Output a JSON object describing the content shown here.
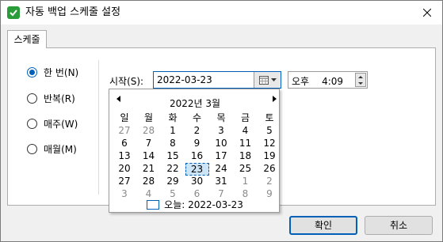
{
  "window": {
    "title": "자동 백업 스케줄 설정"
  },
  "tab": {
    "label": "스케줄"
  },
  "radios": [
    {
      "label": "한 번(N)",
      "checked": true
    },
    {
      "label": "반복(R)",
      "checked": false
    },
    {
      "label": "매주(W)",
      "checked": false
    },
    {
      "label": "매월(M)",
      "checked": false
    }
  ],
  "start": {
    "label": "시작(S):",
    "date_value": "2022-03-23"
  },
  "time": {
    "ampm": "오후",
    "value": "4:09"
  },
  "calendar": {
    "title": "2022년 3월",
    "weekdays": [
      "일",
      "월",
      "화",
      "수",
      "목",
      "금",
      "토"
    ],
    "weeks": [
      [
        "27",
        "28",
        "1",
        "2",
        "3",
        "4",
        "5"
      ],
      [
        "6",
        "7",
        "8",
        "9",
        "10",
        "11",
        "12"
      ],
      [
        "13",
        "14",
        "15",
        "16",
        "17",
        "18",
        "19"
      ],
      [
        "20",
        "21",
        "22",
        "23",
        "24",
        "25",
        "26"
      ],
      [
        "27",
        "28",
        "29",
        "30",
        "31",
        "1",
        "2"
      ],
      [
        "3",
        "4",
        "5",
        "6",
        "7",
        "8",
        "9"
      ]
    ],
    "selected_day": "23",
    "today_label": "오늘: 2022-03-23"
  },
  "buttons": {
    "ok": "확인",
    "cancel": "취소"
  },
  "colors": {
    "accent": "#005fb8",
    "app_icon": "#2a9d3a",
    "selected_bg": "#cce4f7"
  }
}
